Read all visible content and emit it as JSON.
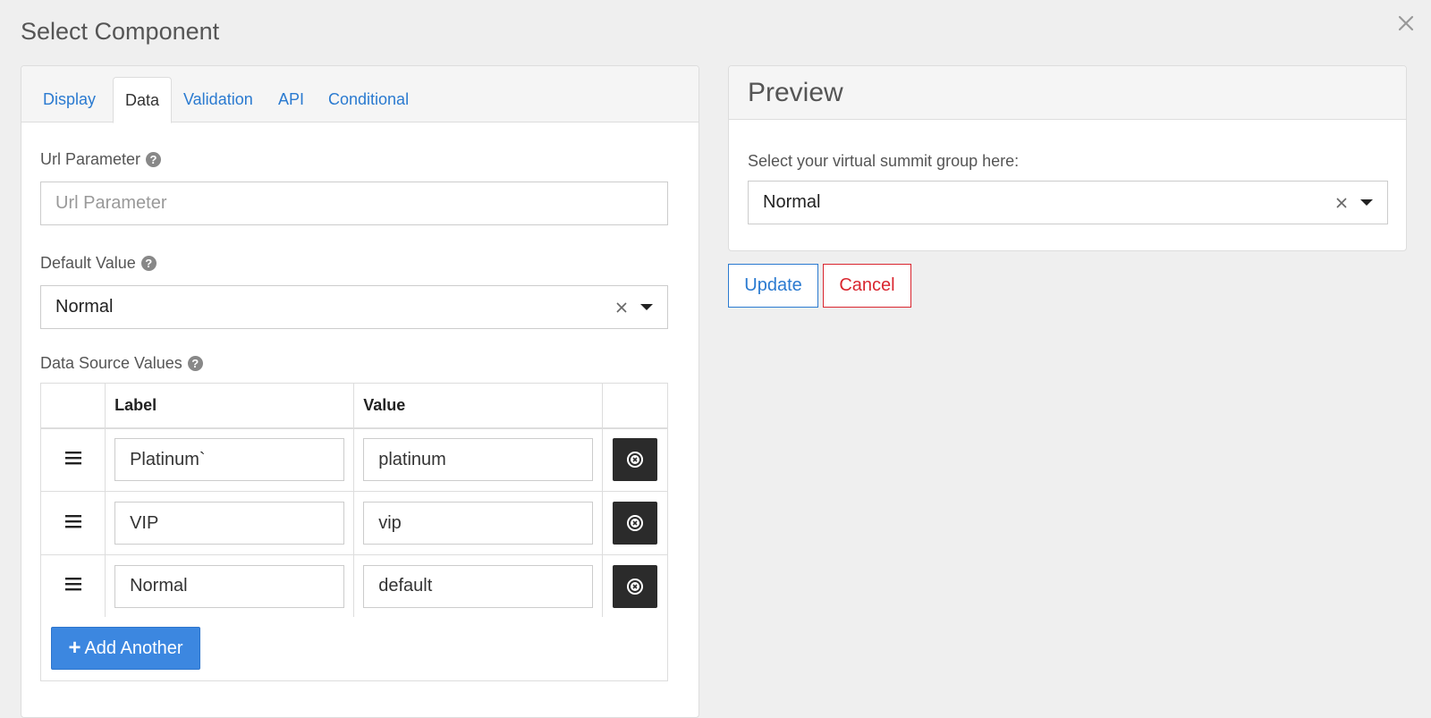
{
  "modal": {
    "title": "Select Component"
  },
  "tabs": [
    {
      "label": "Display",
      "active": false
    },
    {
      "label": "Data",
      "active": true
    },
    {
      "label": "Validation",
      "active": false
    },
    {
      "label": "API",
      "active": false
    },
    {
      "label": "Conditional",
      "active": false
    }
  ],
  "url_parameter": {
    "label": "Url Parameter",
    "placeholder": "Url Parameter",
    "value": ""
  },
  "default_value": {
    "label": "Default Value",
    "selected": "Normal"
  },
  "data_source": {
    "label": "Data Source Values",
    "columns": {
      "label": "Label",
      "value": "Value"
    },
    "rows": [
      {
        "label": "Platinum`",
        "value": "platinum"
      },
      {
        "label": "VIP",
        "value": "vip"
      },
      {
        "label": "Normal",
        "value": "default"
      }
    ],
    "add_button": "Add Another"
  },
  "preview": {
    "title": "Preview",
    "field_label": "Select your virtual summit group here:",
    "selected": "Normal"
  },
  "actions": {
    "update": "Update",
    "cancel": "Cancel"
  },
  "colors": {
    "link": "#2a7ad0",
    "primary_button": "#3c87e0",
    "danger": "#d9262f",
    "dark_button": "#2b2b2b"
  }
}
